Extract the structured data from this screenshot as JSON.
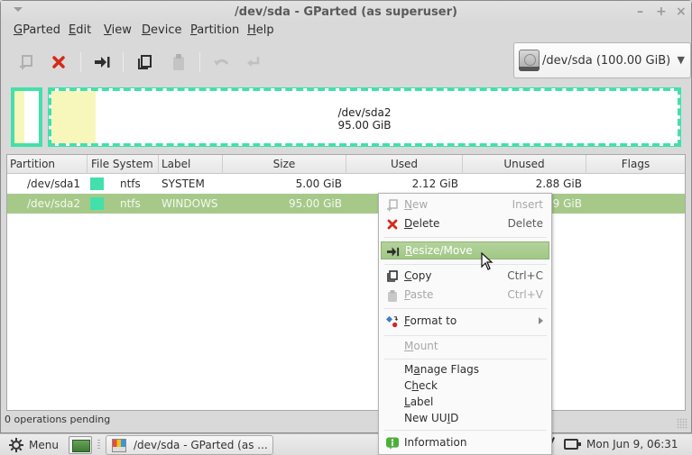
{
  "window": {
    "title": "/dev/sda - GParted (as superuser)",
    "controls": {
      "minimize": "–",
      "maximize": "+",
      "close": "×"
    }
  },
  "menubar": [
    {
      "label": "GParted",
      "mnemonic": "G",
      "rest": "Parted"
    },
    {
      "label": "Edit",
      "mnemonic": "E",
      "rest": "dit"
    },
    {
      "label": "View",
      "mnemonic": "V",
      "rest": "iew"
    },
    {
      "label": "Device",
      "mnemonic": "D",
      "rest": "evice"
    },
    {
      "label": "Partition",
      "mnemonic": "P",
      "rest": "artition"
    },
    {
      "label": "Help",
      "mnemonic": "H",
      "rest": "elp"
    }
  ],
  "toolbar": {
    "buttons": [
      {
        "name": "new",
        "icon": "new-partition-icon",
        "enabled": false
      },
      {
        "name": "delete",
        "icon": "delete-icon",
        "enabled": true
      },
      {
        "name": "resize-move",
        "icon": "resize-move-icon",
        "enabled": true
      },
      {
        "name": "copy",
        "icon": "copy-icon",
        "enabled": true
      },
      {
        "name": "paste",
        "icon": "paste-icon",
        "enabled": false
      },
      {
        "name": "undo",
        "icon": "undo-icon",
        "enabled": false
      },
      {
        "name": "apply",
        "icon": "apply-icon",
        "enabled": false
      }
    ]
  },
  "device_selector": {
    "icon": "hard-disk-icon",
    "value": "/dev/sda  (100.00 GiB)",
    "arrow": "▼"
  },
  "disk_graph": {
    "partitions": [
      {
        "name": "/dev/sda1",
        "size": "5.00 GiB",
        "used_fraction": 0.42,
        "color": "#43e0aa"
      },
      {
        "name": "/dev/sda2",
        "size": "95.00 GiB",
        "used_fraction": 0.07,
        "color": "#43e0aa",
        "selected": true
      }
    ],
    "selected_label_line1": "/dev/sda2",
    "selected_label_line2": "95.00 GiB"
  },
  "table": {
    "columns": [
      "Partition",
      "File System",
      "Label",
      "Size",
      "Used",
      "Unused",
      "Flags"
    ],
    "rows": [
      {
        "partition": "/dev/sda1",
        "fs_color": "#43e0aa",
        "filesystem": "ntfs",
        "label": "SYSTEM",
        "size": "5.00 GiB",
        "used": "2.12 GiB",
        "unused": "2.88 GiB",
        "flags": "",
        "selected": false
      },
      {
        "partition": "/dev/sda2",
        "fs_color": "#43e0aa",
        "filesystem": "ntfs",
        "label": "WINDOWS",
        "size": "95.00 GiB",
        "used": "",
        "unused": "9 GiB",
        "flags": "",
        "selected": true
      }
    ]
  },
  "status": {
    "text": "0 operations pending"
  },
  "context_menu": {
    "items": [
      {
        "pre": "",
        "mn": "N",
        "post": "ew",
        "accel": "Insert",
        "icon": "new-partition-icon",
        "disabled": true
      },
      {
        "pre": "",
        "mn": "D",
        "post": "elete",
        "accel": "Delete",
        "icon": "delete-icon",
        "disabled": false
      },
      {
        "pre": "",
        "mn": "R",
        "post": "esize/Move",
        "accel": "",
        "icon": "resize-move-icon",
        "disabled": false,
        "hover": true
      },
      {
        "pre": "",
        "mn": "C",
        "post": "opy",
        "accel": "Ctrl+C",
        "icon": "copy-icon",
        "disabled": false
      },
      {
        "pre": "",
        "mn": "P",
        "post": "aste",
        "accel": "Ctrl+V",
        "icon": "paste-icon",
        "disabled": true
      },
      {
        "pre": "",
        "mn": "F",
        "post": "ormat to",
        "accel": "",
        "icon": "format-icon",
        "disabled": false,
        "submenu": true
      },
      {
        "pre": "",
        "mn": "M",
        "post": "ount",
        "accel": "",
        "icon": "",
        "disabled": true
      },
      {
        "pre": "M",
        "mn": "a",
        "post": "nage Flags",
        "accel": "",
        "icon": "",
        "disabled": false
      },
      {
        "pre": "C",
        "mn": "h",
        "post": "eck",
        "accel": "",
        "icon": "",
        "disabled": false
      },
      {
        "pre": "",
        "mn": "L",
        "post": "abel",
        "accel": "",
        "icon": "",
        "disabled": false
      },
      {
        "pre": "New UU",
        "mn": "I",
        "post": "D",
        "accel": "",
        "icon": "",
        "disabled": false
      },
      {
        "pre": "",
        "mn": "",
        "post": "Information",
        "accel": "",
        "icon": "information-icon",
        "disabled": false
      }
    ]
  },
  "taskbar": {
    "menu_label": "Menu",
    "task_label": "/dev/sda - GParted (as ...",
    "clock": "Mon Jun  9, 06:31"
  }
}
